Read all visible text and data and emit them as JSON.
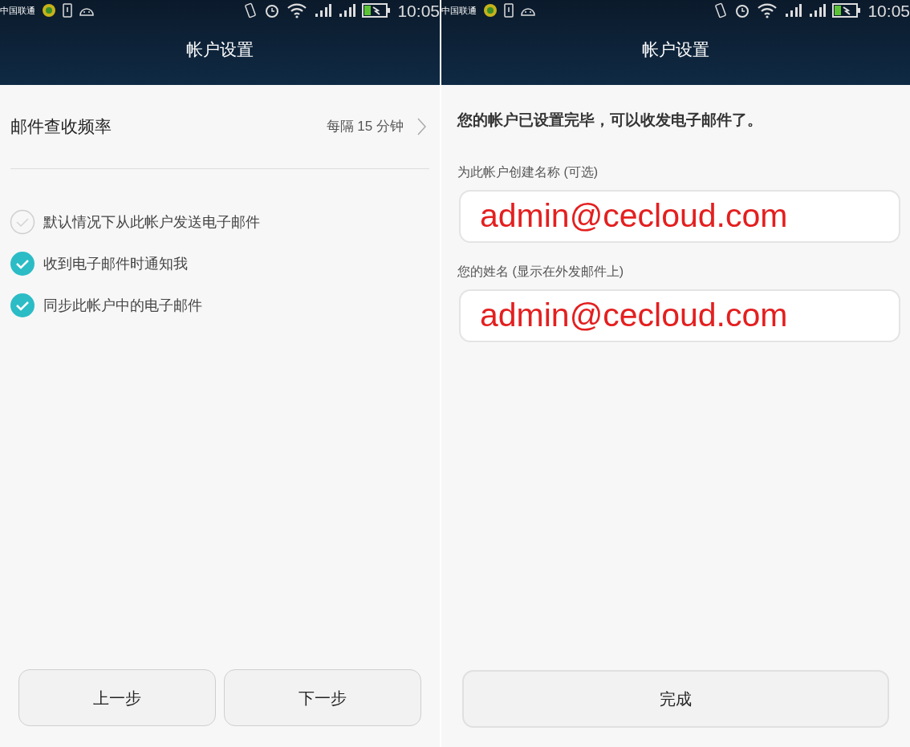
{
  "left_screen": {
    "status_bar": {
      "carrier": "中国联通",
      "time": "10:05"
    },
    "title": "帐户设置",
    "frequency": {
      "label": "邮件查收频率",
      "value": "每隔 15 分钟"
    },
    "options": [
      {
        "label": "默认情况下从此帐户发送电子邮件",
        "checked": false
      },
      {
        "label": "收到电子邮件时通知我",
        "checked": true
      },
      {
        "label": "同步此帐户中的电子邮件",
        "checked": true
      }
    ],
    "buttons": [
      "上一步",
      "下一步"
    ]
  },
  "right_screen": {
    "status_bar": {
      "carrier": "中国联通",
      "time": "10:05"
    },
    "title": "帐户设置",
    "message": "您的帐户已设置完毕，可以收发电子邮件了。",
    "fields": [
      {
        "label": "为此帐户创建名称 (可选)",
        "value": "admin@cecloud.com"
      },
      {
        "label": "您的姓名 (显示在外发邮件上)",
        "value": "admin@cecloud.com"
      }
    ],
    "buttons": [
      "完成"
    ]
  }
}
